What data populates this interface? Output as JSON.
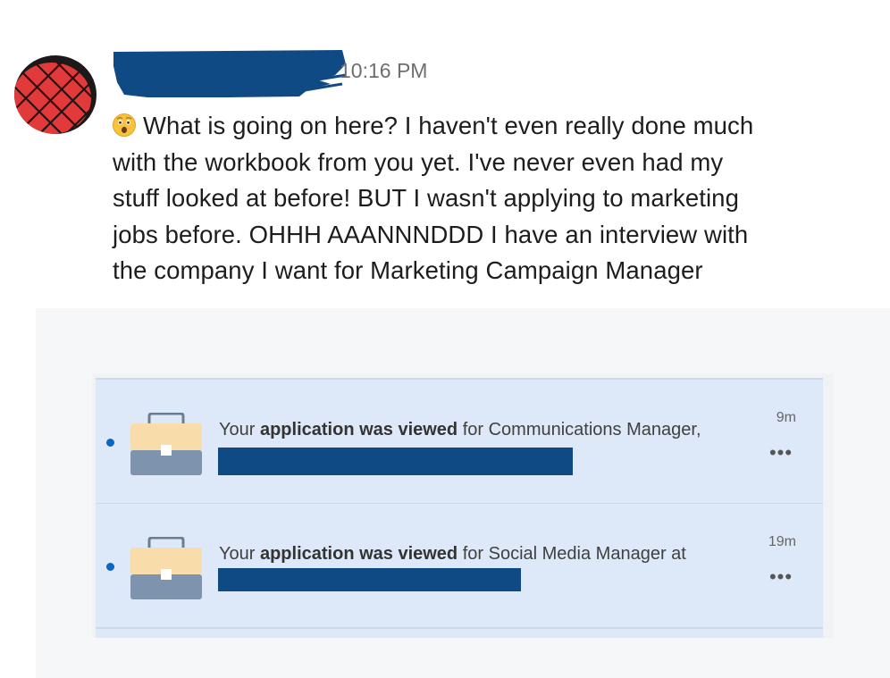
{
  "message": {
    "timestamp": "10:16 PM",
    "emoji": "astonished-face-emoji",
    "text": "What is going on here?  I haven't even really done much\nwith the workbook from you yet. I've never even had my\nstuff looked at before!  BUT I wasn't applying to marketing\njobs before. OHHH AAANNNDDD I have an interview with\nthe company I want for Marketing Campaign Manager"
  },
  "notifications": [
    {
      "prefix": "Your ",
      "bold": "application was viewed",
      "suffix": " for Communications Manager,",
      "age": "9m",
      "more": "•••",
      "icon": "briefcase-icon",
      "unread": true
    },
    {
      "prefix": "Your ",
      "bold": "application was viewed",
      "suffix": " for Social Media Manager at",
      "age": "19m",
      "more": "•••",
      "icon": "briefcase-icon",
      "unread": true
    }
  ],
  "colors": {
    "redaction": "#0f4a84",
    "notification_bg": "#dde9f8",
    "unread_dot": "#0a66c2",
    "avatar_red": "#e23a3a"
  }
}
